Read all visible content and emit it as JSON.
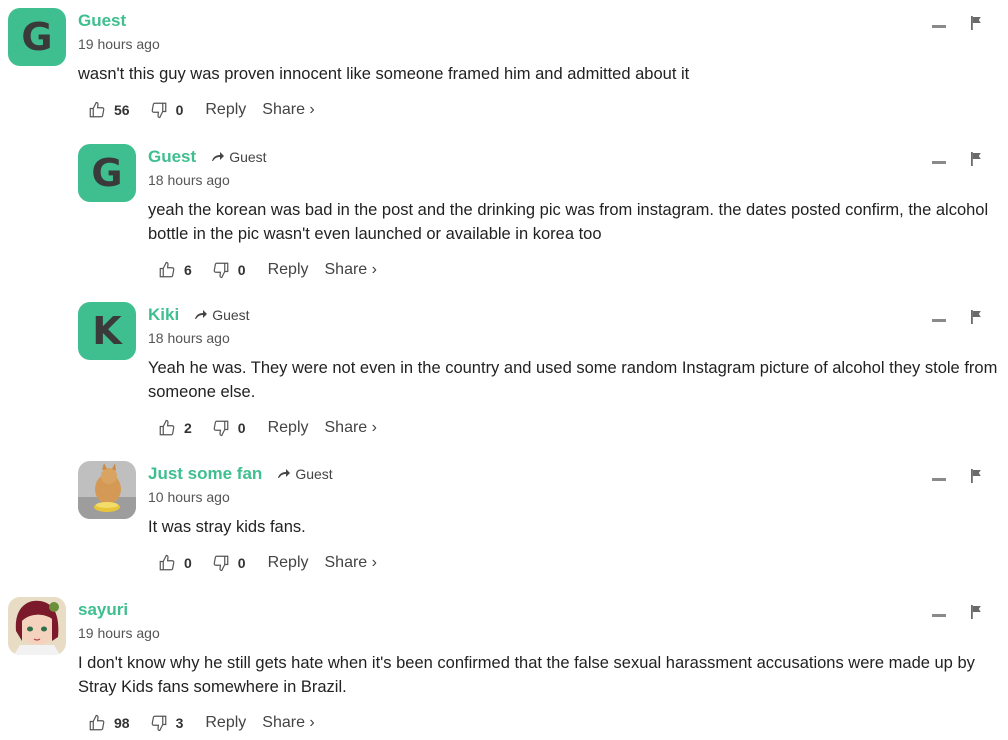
{
  "ui": {
    "reply_label": "Reply",
    "share_label": "Share ›"
  },
  "comments": [
    {
      "author": "Guest",
      "avatar_letter": "G",
      "time": "19 hours ago",
      "text": "wasn't this guy was proven innocent like someone framed him and admitted about it",
      "likes": "56",
      "dislikes": "0"
    },
    {
      "author": "Guest",
      "avatar_letter": "G",
      "reply_to": "Guest",
      "time": "18 hours ago",
      "text": "yeah the korean was bad in the post and the drinking pic was from instagram. the dates posted confirm, the alcohol bottle in the pic wasn't even launched or available in korea too",
      "likes": "6",
      "dislikes": "0"
    },
    {
      "author": "Kiki",
      "avatar_letter": "K",
      "reply_to": "Guest",
      "time": "18 hours ago",
      "text": "Yeah he was. They were not even in the country and used some random Instagram picture of alcohol they stole from someone else.",
      "likes": "2",
      "dislikes": "0"
    },
    {
      "author": "Just some fan",
      "reply_to": "Guest",
      "time": "10 hours ago",
      "text": "It was stray kids fans.",
      "likes": "0",
      "dislikes": "0"
    },
    {
      "author": "sayuri",
      "time": "19 hours ago",
      "text": "I don't know why he still gets hate when it's been confirmed that the false sexual harassment accusations were made up by Stray Kids fans somewhere in Brazil.",
      "likes": "98",
      "dislikes": "3"
    }
  ],
  "colors": {
    "accent": "#3fbf8f",
    "text": "#222222"
  },
  "icons": [
    "thumbs-up-icon",
    "thumbs-down-icon",
    "reply-arrow-icon",
    "minimize-icon",
    "flag-icon"
  ]
}
